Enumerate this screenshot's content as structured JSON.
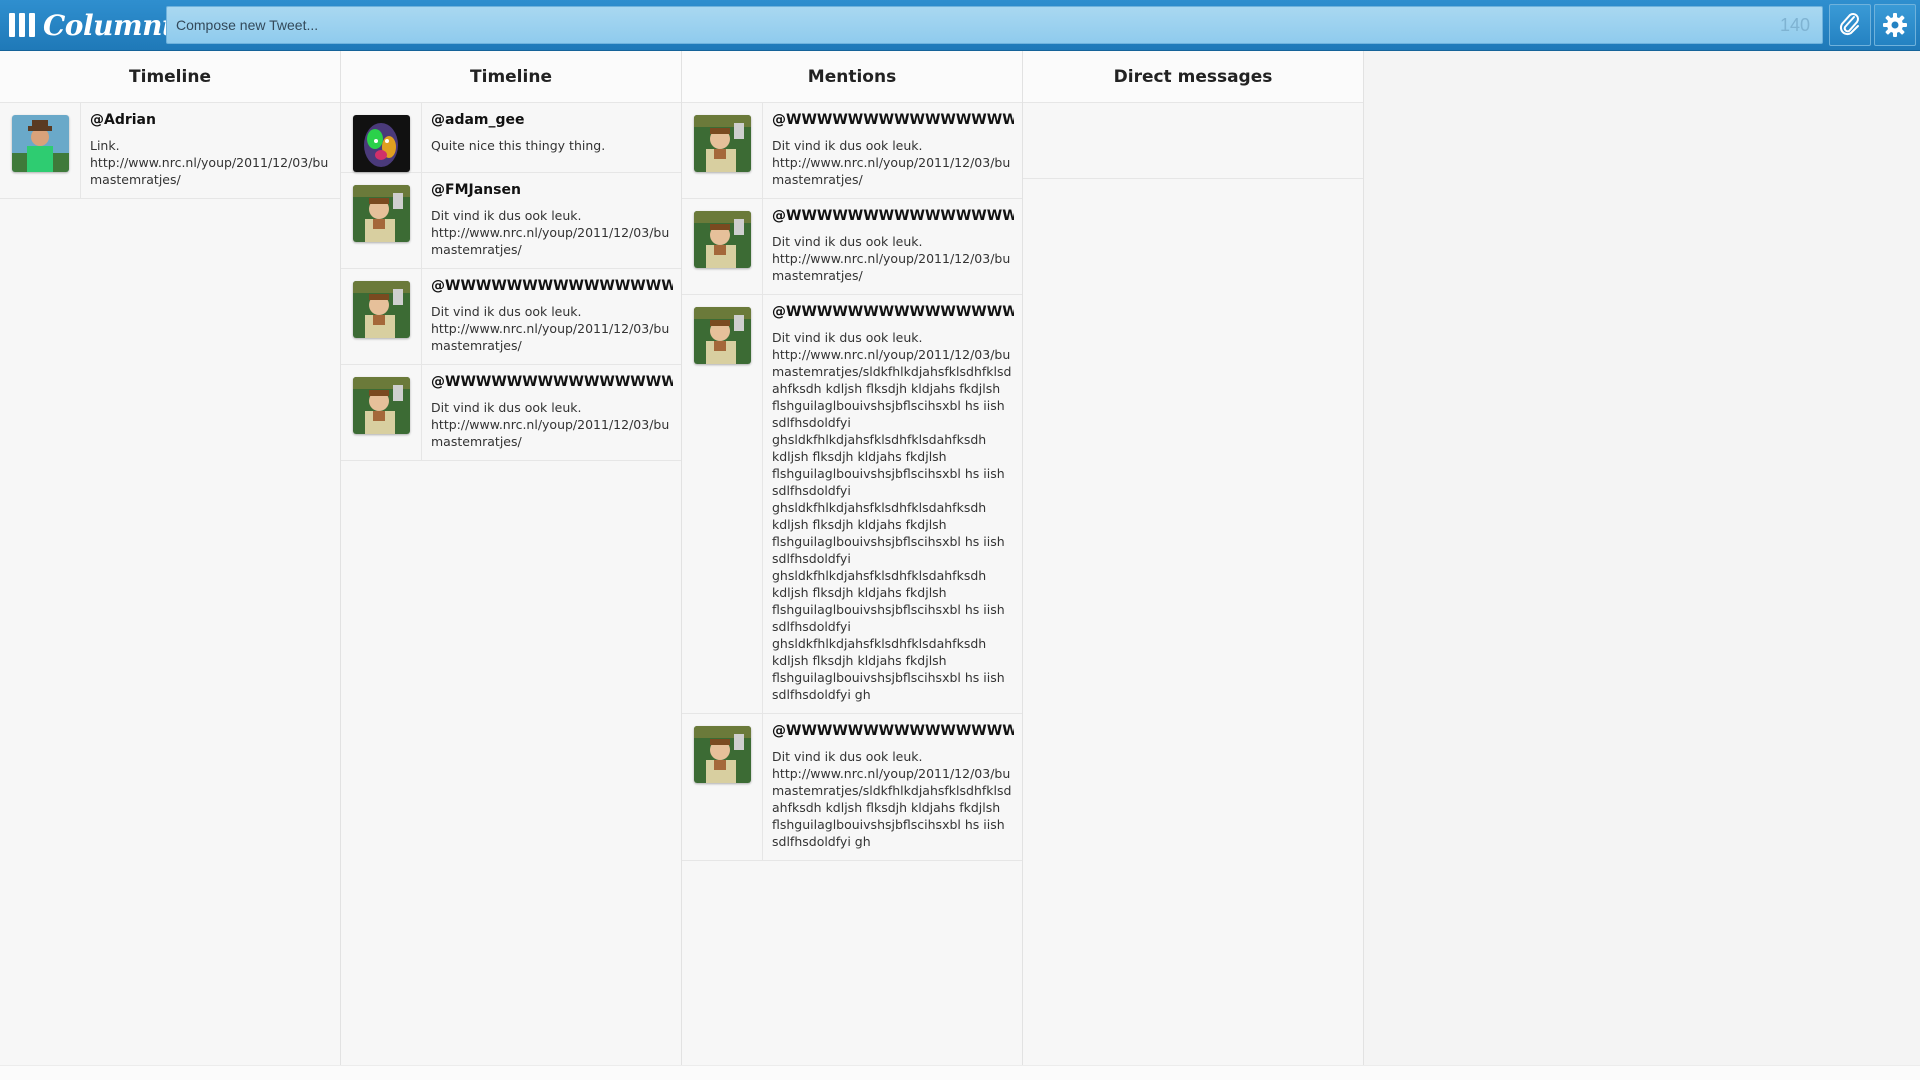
{
  "app": {
    "logo_text": "Column",
    "logo_suffix": "t",
    "compose_placeholder": "Compose new Tweet...",
    "char_counter": "140",
    "accent_color": "#2a8ace"
  },
  "columns": [
    {
      "title": "Timeline",
      "tweets": [
        {
          "user": "@Adrian",
          "text": "Link.\nhttp://www.nrc.nl/youp/2011/12/03/bumastemratjes/",
          "avatar": "man-hat"
        }
      ]
    },
    {
      "title": "Timeline",
      "tweets": [
        {
          "user": "@adam_gee",
          "text": "Quite nice this thingy thing.",
          "avatar": "colorful-face"
        },
        {
          "user": "@FMJansen",
          "text": "Dit vind ik dus ook leuk.\nhttp://www.nrc.nl/youp/2011/12/03/bumastemratjes/",
          "avatar": "boy-green"
        },
        {
          "user": "@WWWWWWWWWWWWWWW",
          "text": "Dit vind ik dus ook leuk.\nhttp://www.nrc.nl/youp/2011/12/03/bumastemratjes/",
          "avatar": "boy-green"
        },
        {
          "user": "@WWWWWWWWWWWWWWW",
          "text": "Dit vind ik dus ook leuk.\nhttp://www.nrc.nl/youp/2011/12/03/bumastemratjes/",
          "avatar": "boy-green"
        }
      ]
    },
    {
      "title": "Mentions",
      "tweets": [
        {
          "user": "@WWWWWWWWWWWWWWW",
          "text": "Dit vind ik dus ook leuk.\nhttp://www.nrc.nl/youp/2011/12/03/bumastemratjes/",
          "avatar": "boy-green"
        },
        {
          "user": "@WWWWWWWWWWWWWWW",
          "text": "Dit vind ik dus ook leuk.\nhttp://www.nrc.nl/youp/2011/12/03/bumastemratjes/",
          "avatar": "boy-green"
        },
        {
          "user": "@WWWWWWWWWWWWWWW",
          "text": "Dit vind ik dus ook leuk.\nhttp://www.nrc.nl/youp/2011/12/03/bumastemratjes/sldkfhlkdjahsfklsdhfklsdahfksdh kdljsh flksdjh kldjahs fkdjlsh flshguilaglbouivshsjbflscihsxbl hs iish sdlfhsdoldfyi\nghsldkfhlkdjahsfklsdhfklsdahfksdh kdljsh flksdjh kldjahs fkdjlsh flshguilaglbouivshsjbflscihsxbl hs iish sdlfhsdoldfyi\nghsldkfhlkdjahsfklsdhfklsdahfksdh kdljsh flksdjh kldjahs fkdjlsh flshguilaglbouivshsjbflscihsxbl hs iish sdlfhsdoldfyi\nghsldkfhlkdjahsfklsdhfklsdahfksdh kdljsh flksdjh kldjahs fkdjlsh flshguilaglbouivshsjbflscihsxbl hs iish sdlfhsdoldfyi\nghsldkfhlkdjahsfklsdhfklsdahfksdh kdljsh flksdjh kldjahs fkdjlsh flshguilaglbouivshsjbflscihsxbl hs iish sdlfhsdoldfyi gh",
          "avatar": "boy-green"
        },
        {
          "user": "@WWWWWWWWWWWWWWW",
          "text": "Dit vind ik dus ook leuk.\nhttp://www.nrc.nl/youp/2011/12/03/bumastemratjes/sldkfhlkdjahsfklsdhfklsdahfksdh kdljsh flksdjh kldjahs fkdjlsh flshguilaglbouivshsjbflscihsxbl hs iish sdlfhsdoldfyi gh",
          "avatar": "boy-green"
        }
      ]
    },
    {
      "title": "Direct messages",
      "tweets": []
    }
  ]
}
